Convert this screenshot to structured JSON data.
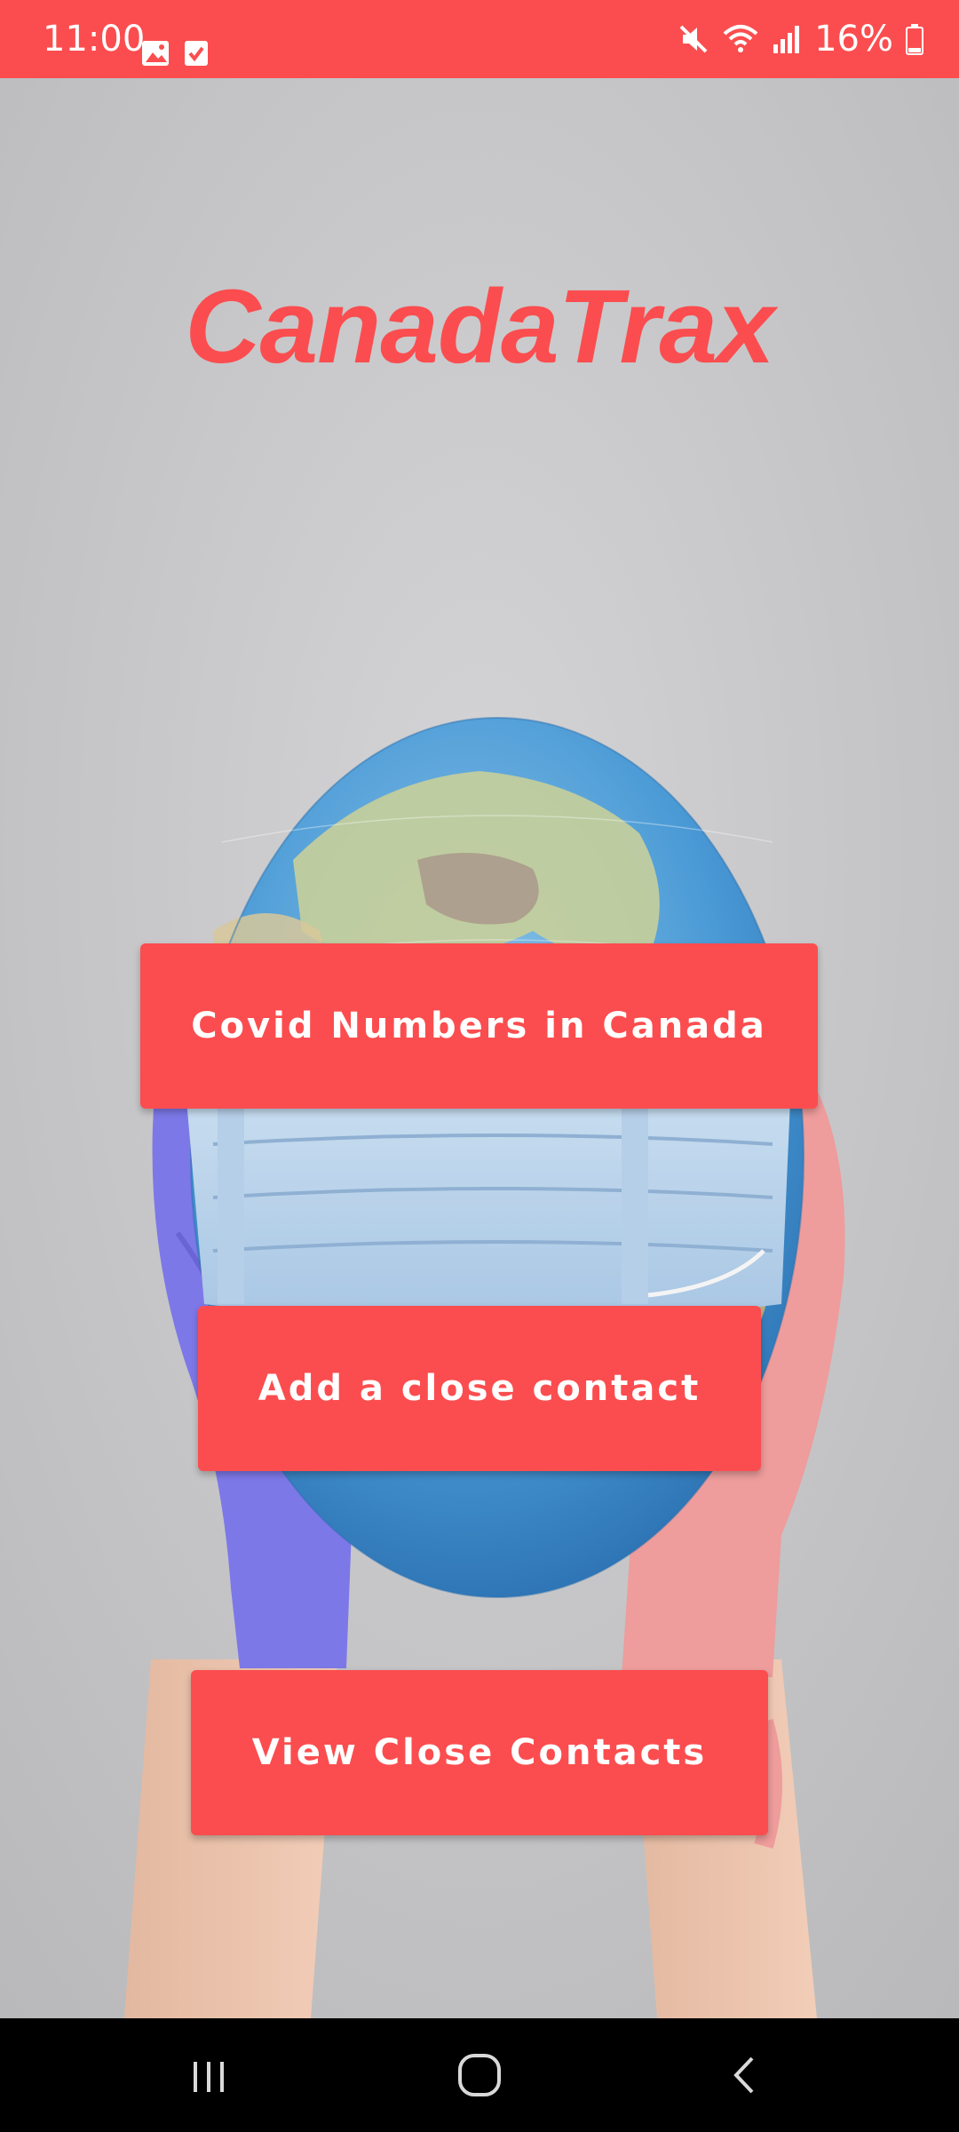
{
  "status_bar": {
    "time": "11:00",
    "battery": "16%",
    "icons": [
      "image-icon",
      "check-square-icon",
      "mute-icon",
      "wifi-icon",
      "signal-icon",
      "battery-icon"
    ]
  },
  "app": {
    "title": "CanadaTrax"
  },
  "buttons": {
    "covid_numbers": "Covid Numbers in Canada",
    "add_contact": "Add a close contact",
    "view_contacts": "View Close Contacts"
  },
  "nav_bar": {
    "icons": [
      "recents-icon",
      "home-icon",
      "back-icon"
    ]
  },
  "colors": {
    "accent": "#fb4d4f",
    "background": "#c9c9cb",
    "nav": "#000000"
  }
}
